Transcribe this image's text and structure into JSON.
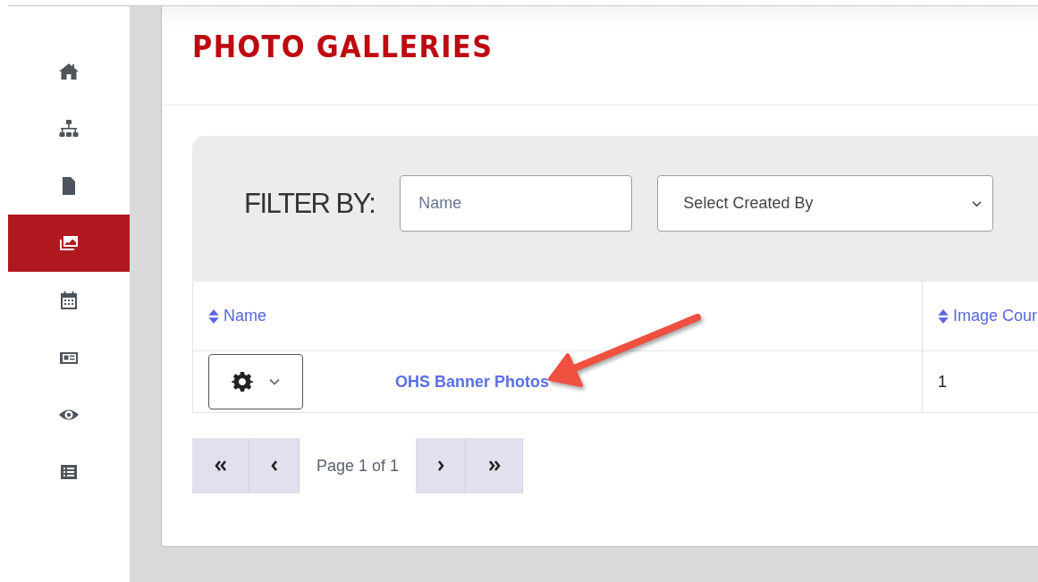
{
  "sidebar": {
    "items": [
      {
        "selected": false
      },
      {
        "selected": false
      },
      {
        "selected": false
      },
      {
        "selected": true
      },
      {
        "selected": false
      },
      {
        "selected": false
      },
      {
        "selected": false
      },
      {
        "selected": false
      }
    ]
  },
  "page": {
    "title": "PHOTO GALLERIES"
  },
  "filter": {
    "label": "FILTER BY:",
    "name_field": {
      "placeholder": "Name"
    },
    "created_by_select": {
      "value": "Select Created By"
    }
  },
  "table": {
    "columns": [
      "Name",
      "Image Cour"
    ],
    "rows": [
      {
        "name": "OHS Banner Photos",
        "image_count": "1"
      }
    ]
  },
  "pagination": {
    "label": "Page 1 of 1"
  }
}
